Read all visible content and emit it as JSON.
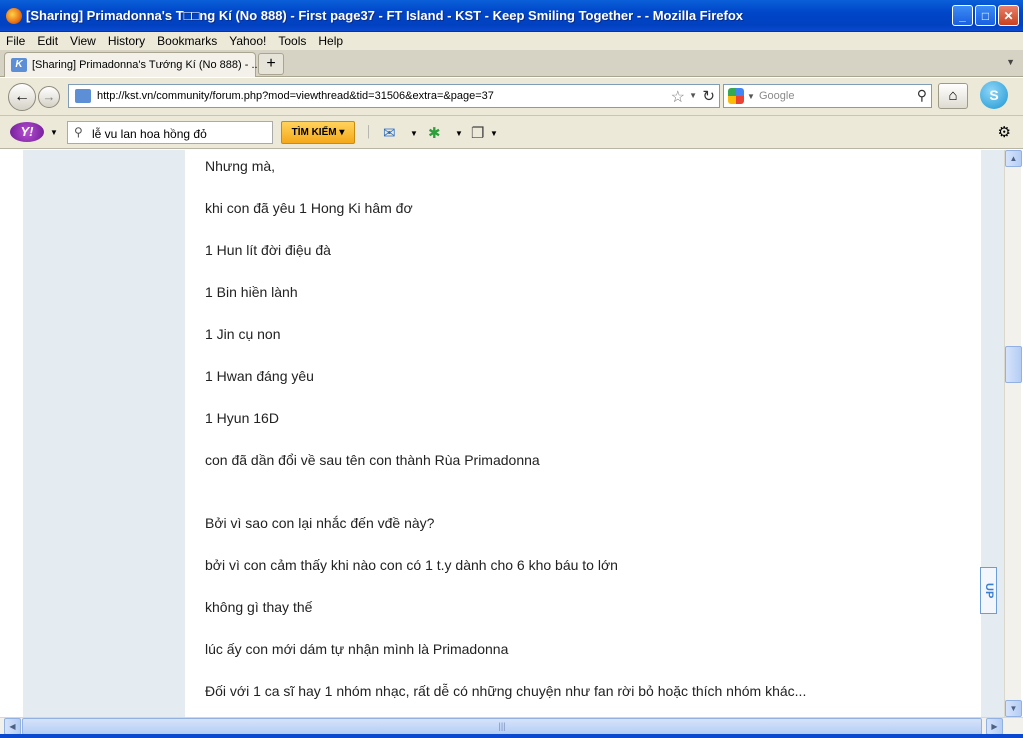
{
  "window": {
    "title": "[Sharing] Primadonna's T□□ng Kí (No 888) - First page37 - FT Island - KST - Keep Smiling Together - - Mozilla Firefox",
    "minimize_glyph": "_",
    "maximize_glyph": "□",
    "close_glyph": "✕"
  },
  "menu": [
    "File",
    "Edit",
    "View",
    "History",
    "Bookmarks",
    "Yahoo!",
    "Tools",
    "Help"
  ],
  "tabs": [
    {
      "label": "[Sharing] Primadonna's Tướng Kí (No 888) - ..."
    }
  ],
  "newtab_glyph": "+",
  "navbar": {
    "back_glyph": "←",
    "forward_glyph": "→",
    "url": "http://kst.vn/community/forum.php?mod=viewthread&tid=31506&extra=&page=37",
    "search_placeholder": "Google",
    "home_glyph": "⌂"
  },
  "yahoo_toolbar": {
    "logo_text": "Y!",
    "search_value": "lễ vu lan hoa hồng đỏ",
    "search_button": "TÌM KIẾM"
  },
  "post": {
    "lines": [
      "Nhưng mà,",
      "khi con đã yêu 1 Hong Ki hâm đơ",
      "1 Hun lít đời điệu đà",
      "1 Bin hiền lành",
      "1 Jin cụ non",
      "1 Hwan đáng yêu",
      "1 Hyun 16D",
      "con đã dần đổi về sau tên con thành Rùa Primadonna",
      "Bởi vì sao con lại nhắc đến vđề này?",
      "bởi vì con cảm thấy khi nào con có 1 t.y dành cho 6 kho báu to lớn",
      "không gì thay thế",
      "lúc ấy con mới dám tự nhận mình là Primadonna",
      "Đối với 1 ca sĩ hay 1 nhóm nhạc, rất dễ có những chuyện như fan rời bỏ hoặc thích nhóm khác..."
    ],
    "up_button": "UP"
  }
}
